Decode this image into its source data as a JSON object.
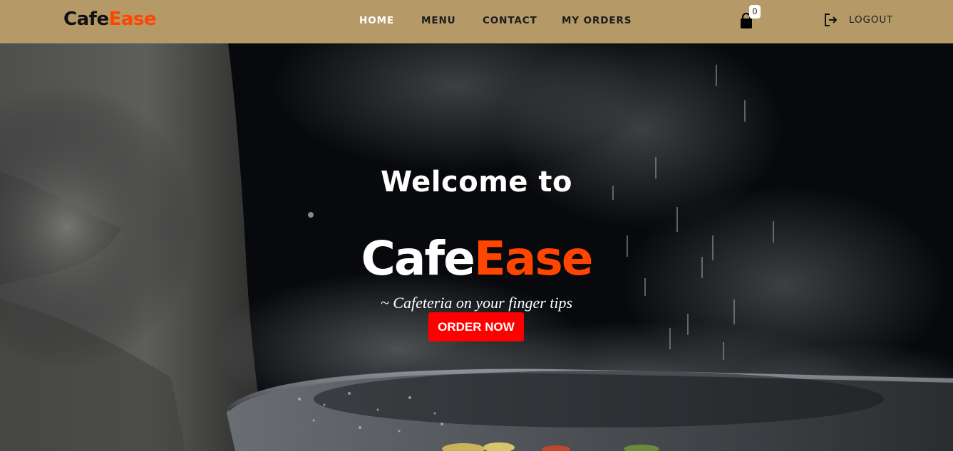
{
  "brand": {
    "part1": "Cafe",
    "part2": "Ease"
  },
  "nav": {
    "home": "HOME",
    "menu": "MENU",
    "contact": "CONTACT",
    "my_orders": "MY ORDERS",
    "active": "HOME"
  },
  "cart": {
    "icon": "shopping-bag-icon",
    "count": "0"
  },
  "logout": {
    "icon": "logout-icon",
    "label": "LOGOUT"
  },
  "hero": {
    "welcome": "Welcome to",
    "brand_part1": "Cafe",
    "brand_part2": "Ease",
    "tagline": "~ Cafeteria on your finger tips",
    "cta": "ORDER NOW",
    "background": "dark kitchen photo with steaming pan"
  },
  "colors": {
    "navbar": "#b59a68",
    "brand_accent": "#ff4500",
    "cta": "#ff0000",
    "active_link": "#ffffff",
    "link": "#1c1c1c"
  }
}
